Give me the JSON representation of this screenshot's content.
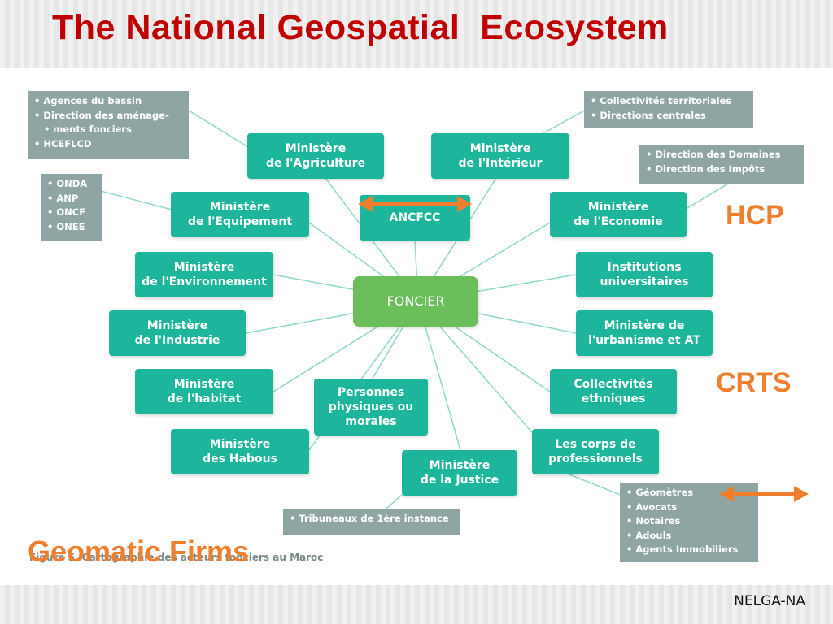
{
  "title": "The National Geospatial  Ecosystem",
  "center": "FONCIER",
  "nodes": {
    "agriculture": "Ministère\nde l'Agriculture",
    "interieur": "Ministère\nde l'Intérieur",
    "equipement": "Ministère\nde l'Equipement",
    "ancfcc": "ANCFCC",
    "economie": "Ministère\nde l'Economie",
    "environnement": "Ministère\nde l'Environnement",
    "institutions": "Institutions\nuniversitaires",
    "industrie": "Ministère\nde l'Industrie",
    "urbanisme": "Ministère de\nl'urbanisme et AT",
    "habitat": "Ministère\nde l'habitat",
    "personnes": "Personnes\nphysiques ou\nmorales",
    "collectivites": "Collectivités\nethniques",
    "habous": "Ministère\ndes Habous",
    "justice": "Ministère\nde la Justice",
    "professionnels": "Les corps de\nprofessionnels"
  },
  "notes": {
    "agences": [
      "Agences du bassin",
      "Direction des aménage-",
      "ments fonciers",
      "HCEFLCD"
    ],
    "onda": [
      "ONDA",
      "ANP",
      "ONCF",
      "ONEE"
    ],
    "collectivites_terr": [
      "Collectivités territoriales",
      "Directions centrales"
    ],
    "domaines": [
      "Direction des Domaines",
      "Direction des Impôts"
    ],
    "tribunaux": [
      "Tribuneaux de 1ère instance"
    ],
    "professions": [
      "Géomètres",
      "Avocats",
      "Notaires",
      "Adouls",
      "Agents Immobiliers"
    ]
  },
  "labels": {
    "hcp": "HCP",
    "crts": "CRTS",
    "geomatic": "Geomatic Firms",
    "caption": "Figure 5. Cartographie des acteurs fonciers au Maroc"
  },
  "footer": "NELGA-NA",
  "colors": {
    "title": "#c00000",
    "node": "#1db59b",
    "center": "#6abf5a",
    "note": "#8ea5a3",
    "accent": "#f07f2d",
    "line": "#8fd8c8"
  },
  "icons": [
    "double-arrow-icon"
  ]
}
